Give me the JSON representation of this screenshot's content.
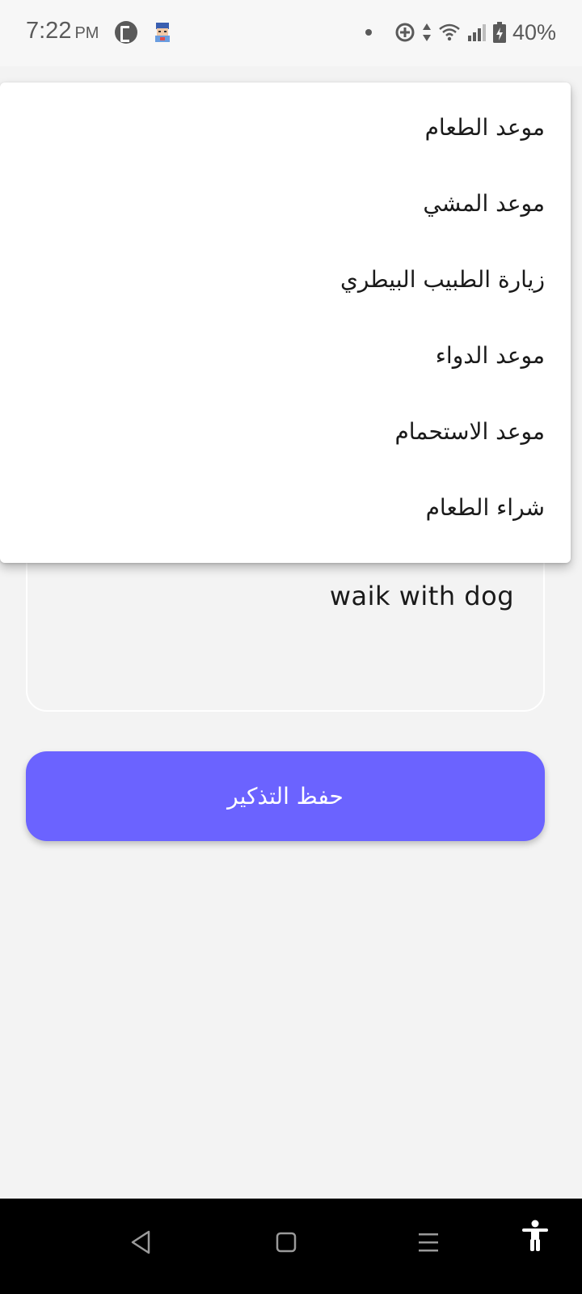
{
  "status_bar": {
    "time": "7:22",
    "ampm": "PM",
    "battery": "40%",
    "icons": [
      "p-app-icon",
      "avatar-app-icon",
      "notification-dot-icon",
      "data-saver-icon",
      "data-arrows-icon",
      "wifi-icon",
      "signal-icon",
      "battery-icon"
    ]
  },
  "menu": {
    "items": [
      {
        "label": "موعد الطعام"
      },
      {
        "label": "موعد المشي"
      },
      {
        "label": "زيارة الطبيب البيطري"
      },
      {
        "label": "موعد الدواء"
      },
      {
        "label": "موعد الاستحمام"
      },
      {
        "label": "شراء الطعام"
      }
    ]
  },
  "note": {
    "value": "waik with dog"
  },
  "save_button": {
    "label": "حفظ التذكير",
    "color": "#6b63ff"
  },
  "nav_bar": {
    "icons": [
      "back-icon",
      "home-icon",
      "menu-icon",
      "accessibility-icon"
    ]
  }
}
